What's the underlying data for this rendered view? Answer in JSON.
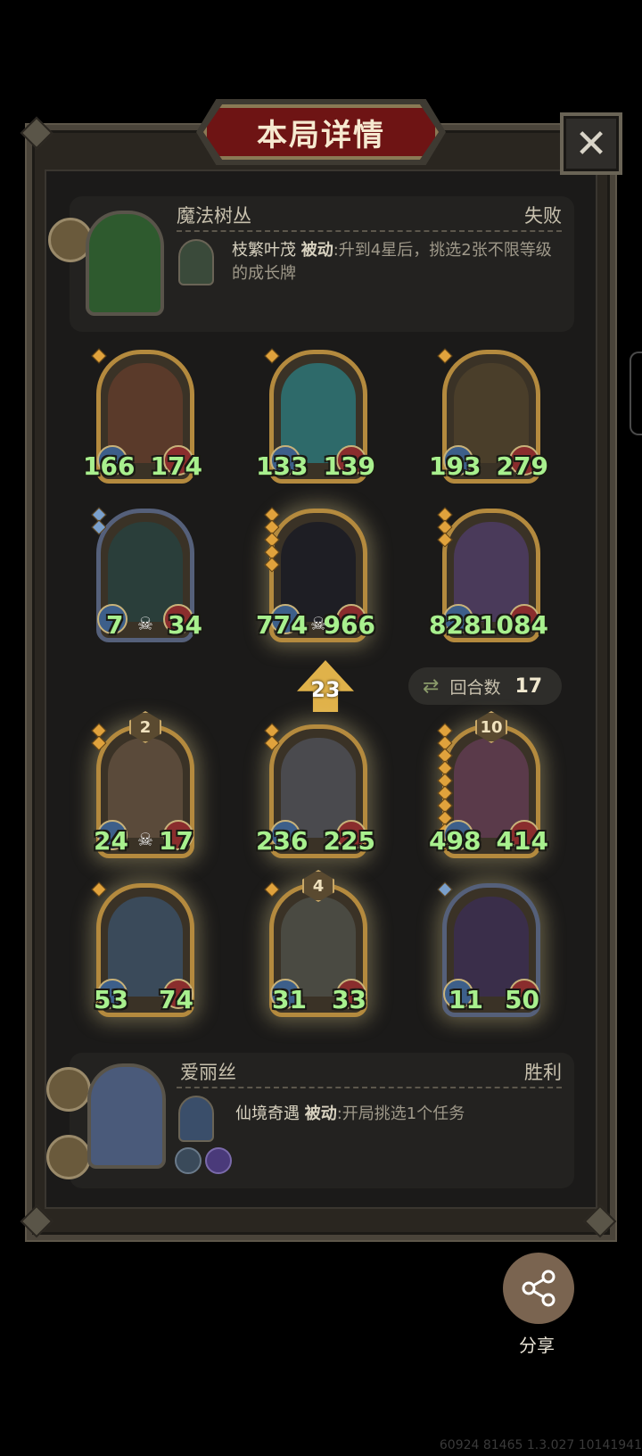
{
  "header": {
    "title": "本局详情",
    "close_icon": "✕"
  },
  "opponent": {
    "name": "魔法树丛",
    "result": "失败",
    "skill_name": "枝繁叶茂",
    "skill_type": "被动",
    "skill_desc": ":升到4星后，挑选2张不限等级的成长牌"
  },
  "opponent_cards": [
    {
      "atk": "166",
      "hp": "174"
    },
    {
      "atk": "133",
      "hp": "139"
    },
    {
      "atk": "193",
      "hp": "279"
    },
    {
      "atk": "7",
      "hp": "34"
    },
    {
      "atk": "774",
      "hp": "966"
    },
    {
      "atk": "828",
      "hp": "1084"
    }
  ],
  "round": {
    "label": "回合数",
    "value": "17"
  },
  "level": {
    "value": "23"
  },
  "player_cards": [
    {
      "atk": "24",
      "hp": "17",
      "badge": "2"
    },
    {
      "atk": "236",
      "hp": "225"
    },
    {
      "atk": "498",
      "hp": "414",
      "badge": "10"
    },
    {
      "atk": "53",
      "hp": "74"
    },
    {
      "atk": "31",
      "hp": "33",
      "badge": "4"
    },
    {
      "atk": "11",
      "hp": "50"
    }
  ],
  "player": {
    "name": "爱丽丝",
    "result": "胜利",
    "skill_name": "仙境奇遇",
    "skill_type": "被动",
    "skill_desc": ":开局挑选1个任务"
  },
  "share": {
    "label": "分享"
  },
  "footer": {
    "build_id": "60924 81465 1.3.027 10141941"
  },
  "colors": {
    "stat_green": "#a8f08e",
    "banner_red": "#6e1414",
    "gold": "#b48a3e"
  },
  "icons": {
    "close": "close-icon",
    "round": "refresh-icon",
    "level": "level-arrow-icon",
    "share": "share-icon"
  }
}
